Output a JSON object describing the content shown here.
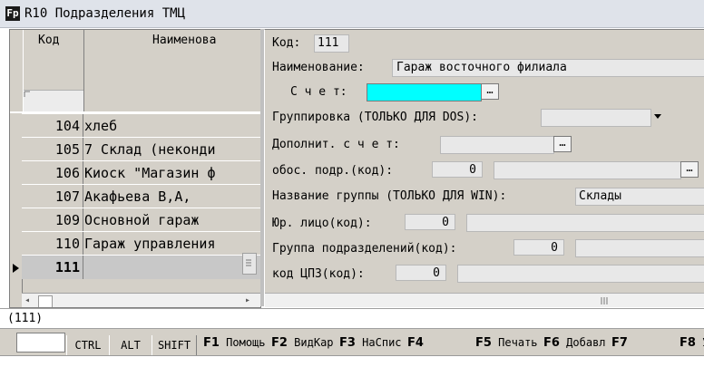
{
  "window": {
    "title": "R10 Подразделения ТМЦ",
    "icon": "app-icon",
    "icon_glyph": "Fp"
  },
  "grid": {
    "headers": {
      "code": "Код",
      "name": "Наименова"
    },
    "rows": [
      {
        "code": "104",
        "name": "хлеб"
      },
      {
        "code": "105",
        "name": "7 Склад (неконди"
      },
      {
        "code": "106",
        "name": "Киоск \"Магазин ф"
      },
      {
        "code": "107",
        "name": "Акафьева В,А,"
      },
      {
        "code": "109",
        "name": "Основной гараж"
      },
      {
        "code": "110",
        "name": "Гараж управления"
      },
      {
        "code": "111",
        "name": ""
      }
    ],
    "selected_index": 6
  },
  "form": {
    "code_label": "Код:",
    "code_value": "111",
    "name_label": "Наименование:",
    "name_value": "Гараж восточного филиала",
    "account_label": "С ч е т:",
    "account_value": "",
    "account_color": "#00ffff",
    "grouping_label": "Группировка (ТОЛЬКО ДЛЯ DOS):",
    "grouping_value": "",
    "extra_account_label": "Дополнит. с ч е т:",
    "extra_account_value": "",
    "sep_unit_label": "обос. подр.(код):",
    "sep_unit_value": "0",
    "sep_unit_name": "",
    "group_name_label": "Название группы (ТОЛЬКО ДЛЯ WIN):",
    "group_name_value": "Склады",
    "legal_entity_label": "Юр. лицо(код):",
    "legal_entity_value": "0",
    "legal_entity_name": "",
    "unit_group_label": "Группа подразделений(код):",
    "unit_group_value": "0",
    "unit_group_name": "",
    "cpz_label": "код ЦПЗ(код):",
    "cpz_value": "0",
    "cpz_name": "",
    "ellipsis": "…"
  },
  "status": {
    "text": "(111)"
  },
  "modifiers": {
    "ctrl": "CTRL",
    "alt": "ALT",
    "shift": "SHIFT"
  },
  "fkeys": [
    {
      "key": "F1",
      "label": "Помощь"
    },
    {
      "key": "F2",
      "label": "ВидКар"
    },
    {
      "key": "F3",
      "label": "НаСпис"
    },
    {
      "key": "F4",
      "label": ""
    },
    {
      "key": "F5",
      "label": "Печать"
    },
    {
      "key": "F6",
      "label": "Добавл"
    },
    {
      "key": "F7",
      "label": ""
    },
    {
      "key": "F8",
      "label": "У"
    }
  ]
}
